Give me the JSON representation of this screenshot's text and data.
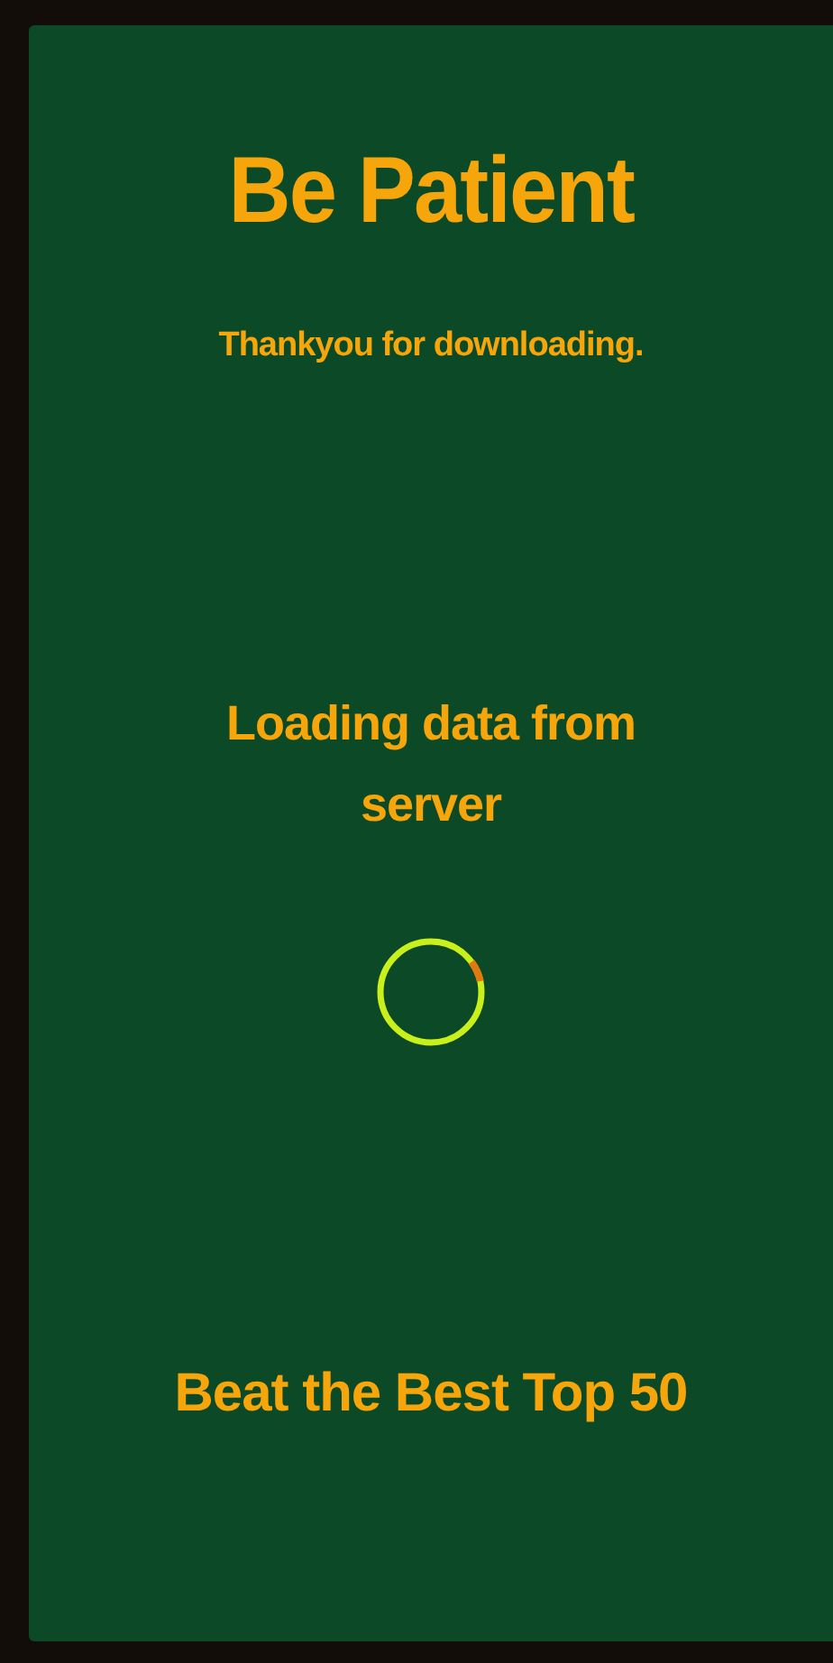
{
  "title": "Be Patient",
  "subtitle": "Thankyou for downloading.",
  "loading_message": "Loading data from server",
  "tagline": "Beat the Best Top 50"
}
